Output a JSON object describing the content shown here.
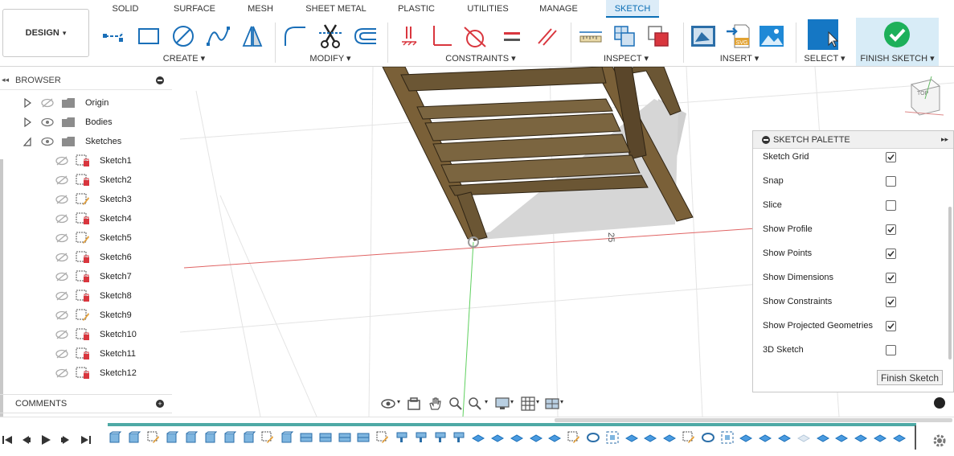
{
  "design_button": {
    "label": "DESIGN",
    "caret": "▾"
  },
  "tabs": [
    "SOLID",
    "SURFACE",
    "MESH",
    "SHEET METAL",
    "PLASTIC",
    "UTILITIES",
    "MANAGE",
    "SKETCH"
  ],
  "active_tab": "SKETCH",
  "groups": {
    "create": "CREATE ▾",
    "modify": "MODIFY ▾",
    "constraints": "CONSTRAINTS ▾",
    "inspect": "INSPECT ▾",
    "insert": "INSERT ▾",
    "select": "SELECT ▾",
    "finish": "FINISH SKETCH ▾"
  },
  "browser": {
    "title": "BROWSER",
    "folders": [
      "Origin",
      "Bodies",
      "Sketches"
    ],
    "sketches": [
      "Sketch1",
      "Sketch2",
      "Sketch3",
      "Sketch4",
      "Sketch5",
      "Sketch6",
      "Sketch7",
      "Sketch8",
      "Sketch9",
      "Sketch10",
      "Sketch11",
      "Sketch12"
    ]
  },
  "comments": {
    "title": "COMMENTS"
  },
  "viewport": {
    "dimension_label": "25",
    "viewcube_label": "TOP"
  },
  "palette": {
    "title": "SKETCH PALETTE",
    "options": [
      {
        "label": "Sketch Grid",
        "checked": true
      },
      {
        "label": "Snap",
        "checked": false
      },
      {
        "label": "Slice",
        "checked": false
      },
      {
        "label": "Show Profile",
        "checked": true
      },
      {
        "label": "Show Points",
        "checked": true
      },
      {
        "label": "Show Dimensions",
        "checked": true
      },
      {
        "label": "Show Constraints",
        "checked": true
      },
      {
        "label": "Show Projected Geometries",
        "checked": true
      },
      {
        "label": "3D Sketch",
        "checked": false
      }
    ],
    "finish_button": "Finish Sketch"
  },
  "colors": {
    "accent": "#0a6eb5",
    "finish_check": "#1db05a",
    "sketch_red": "#d9363e",
    "timeline_bar": "#4ea9a5",
    "wood": "#6b5634"
  }
}
